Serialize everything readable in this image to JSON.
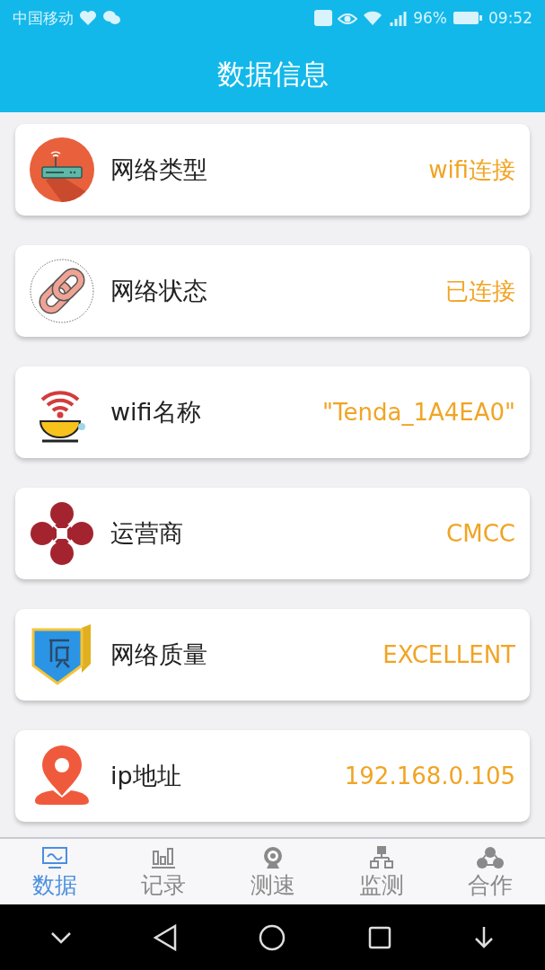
{
  "status_bar": {
    "carrier": "中国移动",
    "battery": "96%",
    "time": "09:52"
  },
  "header": {
    "title": "数据信息"
  },
  "items": [
    {
      "label": "网络类型",
      "value": "wifi连接"
    },
    {
      "label": "网络状态",
      "value": "已连接"
    },
    {
      "label": "wifi名称",
      "value": "\"Tenda_1A4EA0\""
    },
    {
      "label": "运营商",
      "value": "CMCC"
    },
    {
      "label": "网络质量",
      "value": "EXCELLENT"
    },
    {
      "label": "ip地址",
      "value": "192.168.0.105"
    }
  ],
  "tabs": [
    {
      "label": "数据",
      "selected": true
    },
    {
      "label": "记录",
      "selected": false
    },
    {
      "label": "测速",
      "selected": false
    },
    {
      "label": "监测",
      "selected": false
    },
    {
      "label": "合作",
      "selected": false
    }
  ]
}
